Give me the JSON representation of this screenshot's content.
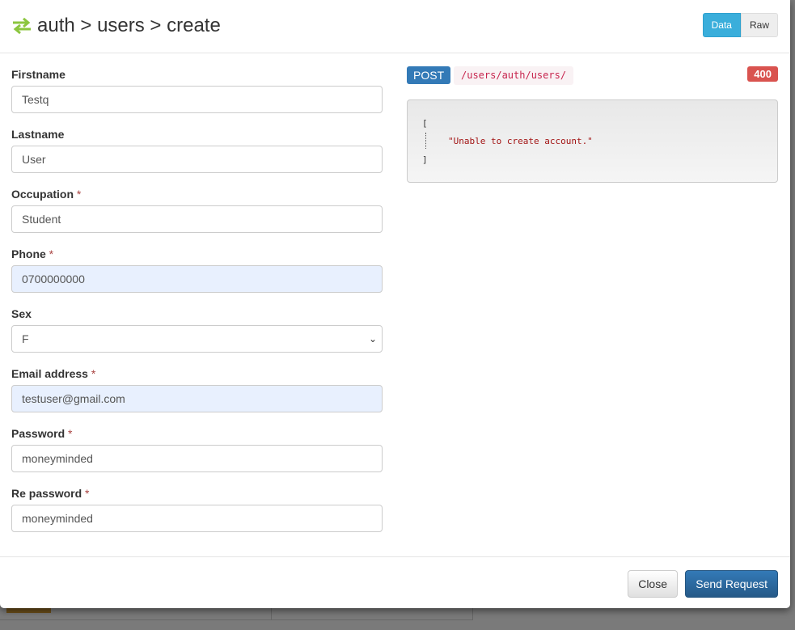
{
  "header": {
    "title": "auth > users > create",
    "toggle": [
      "Data",
      "Raw"
    ]
  },
  "form": {
    "fields": [
      {
        "label": "Firstname",
        "required": false,
        "value": "Testq"
      },
      {
        "label": "Lastname",
        "required": false,
        "value": "User"
      },
      {
        "label": "Occupation",
        "required": true,
        "value": "Student"
      },
      {
        "label": "Phone",
        "required": true,
        "value": "0700000000"
      },
      {
        "label": "Sex",
        "required": false,
        "value": "F"
      },
      {
        "label": "Email address",
        "required": true,
        "value": "testuser@gmail.com"
      },
      {
        "label": "Password",
        "required": true,
        "value": "moneyminded"
      },
      {
        "label": "Re password",
        "required": true,
        "value": "moneyminded"
      }
    ],
    "required_mark": "*"
  },
  "response": {
    "method": "POST",
    "url": "/users/auth/users/",
    "status": "400",
    "open": "[",
    "body": "\"Unable to create account.\"",
    "close": "]"
  },
  "footer": {
    "close": "Close",
    "send": "Send Request"
  }
}
